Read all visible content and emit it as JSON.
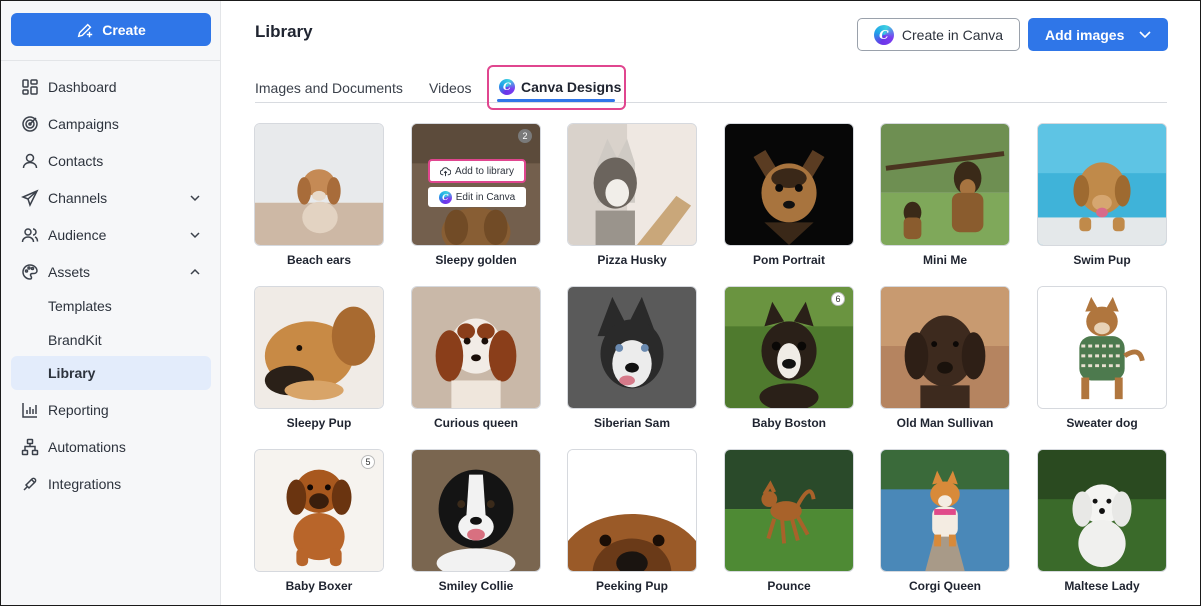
{
  "sidebar": {
    "create_label": "Create",
    "items": [
      {
        "label": "Dashboard",
        "icon": "dashboard-icon"
      },
      {
        "label": "Campaigns",
        "icon": "target-icon"
      },
      {
        "label": "Contacts",
        "icon": "person-icon"
      },
      {
        "label": "Channels",
        "icon": "send-icon",
        "chevron": "down"
      },
      {
        "label": "Audience",
        "icon": "people-icon",
        "chevron": "down"
      },
      {
        "label": "Assets",
        "icon": "palette-icon",
        "chevron": "up"
      },
      {
        "label": "Templates"
      },
      {
        "label": "BrandKit"
      },
      {
        "label": "Library",
        "active": true
      },
      {
        "label": "Reporting",
        "icon": "bar-chart-icon"
      },
      {
        "label": "Automations",
        "icon": "flow-icon"
      },
      {
        "label": "Integrations",
        "icon": "puzzle-icon"
      }
    ]
  },
  "header": {
    "title": "Library",
    "create_in_canva": "Create in Canva",
    "add_images": "Add images"
  },
  "tabs": [
    {
      "label": "Images and Documents"
    },
    {
      "label": "Videos"
    },
    {
      "label": "Canva Designs",
      "active": true
    }
  ],
  "hover_menu": {
    "add_to_library": "Add to library",
    "edit_in_canva": "Edit in Canva"
  },
  "colors": {
    "accent": "#2f76e8",
    "highlight": "#e0468f"
  },
  "cards": [
    {
      "caption": "Beach ears"
    },
    {
      "caption": "Sleepy golden",
      "badge": "2"
    },
    {
      "caption": "Pizza Husky"
    },
    {
      "caption": "Pom Portrait"
    },
    {
      "caption": "Mini Me"
    },
    {
      "caption": "Swim Pup"
    },
    {
      "caption": "Sleepy Pup"
    },
    {
      "caption": "Curious queen"
    },
    {
      "caption": "Siberian Sam"
    },
    {
      "caption": "Baby Boston",
      "badge": "6"
    },
    {
      "caption": "Old Man Sullivan"
    },
    {
      "caption": "Sweater dog"
    },
    {
      "caption": "Baby Boxer",
      "badge": "5"
    },
    {
      "caption": "Smiley Collie"
    },
    {
      "caption": "Peeking Pup"
    },
    {
      "caption": "Pounce"
    },
    {
      "caption": "Corgi Queen"
    },
    {
      "caption": "Maltese Lady"
    }
  ]
}
